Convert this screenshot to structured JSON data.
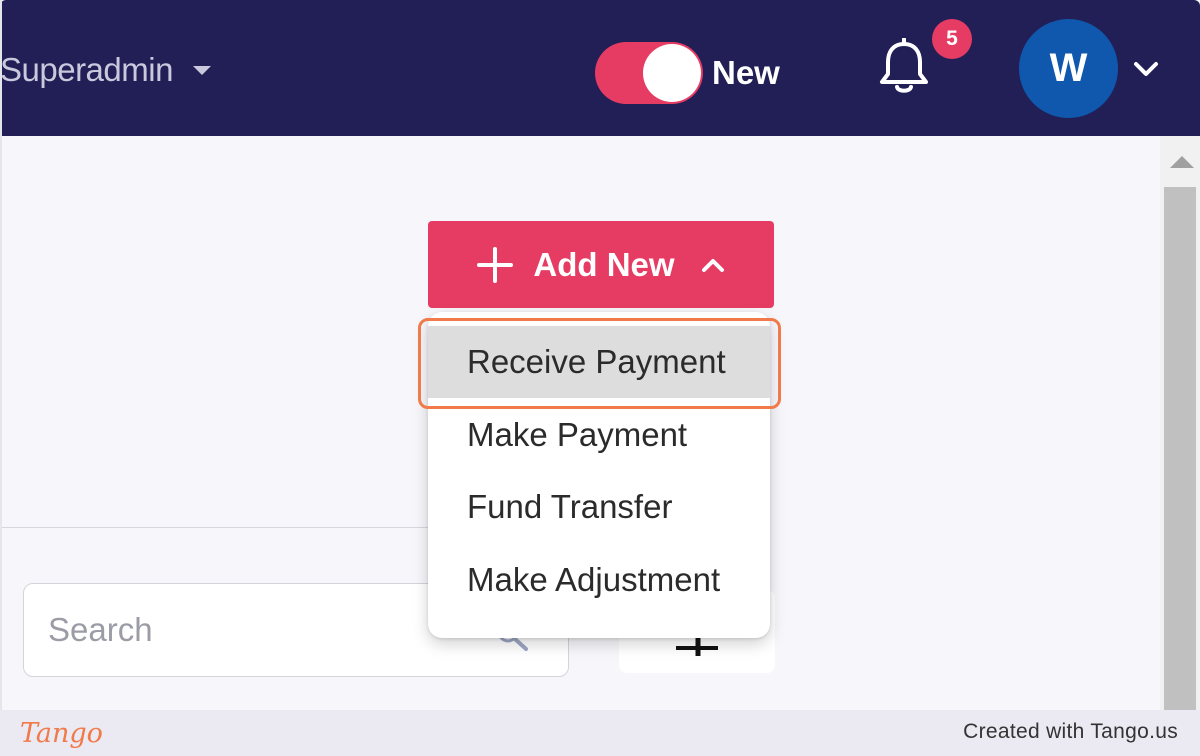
{
  "header": {
    "role_label": "Superadmin",
    "toggle_label": "New",
    "notification_count": "5",
    "avatar_initial": "W"
  },
  "actions": {
    "add_new_label": "Add New",
    "menu_items": [
      {
        "label": "Receive Payment",
        "highlighted": true
      },
      {
        "label": "Make Payment",
        "highlighted": false
      },
      {
        "label": "Fund Transfer",
        "highlighted": false
      },
      {
        "label": "Make Adjustment",
        "highlighted": false
      }
    ]
  },
  "search": {
    "placeholder": "Search"
  },
  "footer": {
    "brand": "Tango",
    "credit": "Created with Tango.us"
  },
  "colors": {
    "header_bg": "#211f56",
    "accent": "#e63c63",
    "avatar_bg": "#0f58ae",
    "highlight": "#f07a4a"
  },
  "icons": [
    "chevron-down-icon",
    "bell-icon",
    "plus-icon",
    "chevron-up-icon",
    "search-icon",
    "filter-icon",
    "scroll-up-icon"
  ]
}
